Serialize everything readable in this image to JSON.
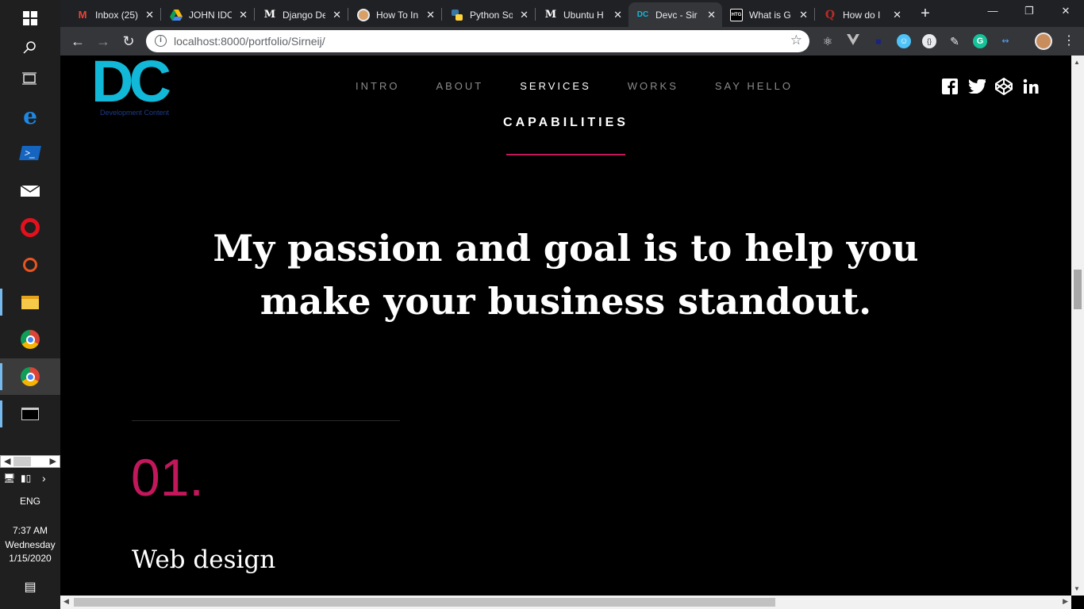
{
  "taskbar": {
    "icons": [
      "windows-start-icon",
      "search-icon",
      "task-view-icon",
      "edge-icon",
      "powershell-icon",
      "mail-icon",
      "opera-icon",
      "ubuntu-icon",
      "file-explorer-icon",
      "chrome-icon",
      "chrome-profile-icon",
      "terminal-icon"
    ],
    "language": "ENG",
    "time": "7:37 AM",
    "day": "Wednesday",
    "date": "1/15/2020"
  },
  "tabs": [
    {
      "title": "Inbox (25)",
      "favicon": "gmail-icon",
      "color": "#ea4335"
    },
    {
      "title": "JOHN IDO",
      "favicon": "drive-icon",
      "color": "#fbbc04"
    },
    {
      "title": "Django De",
      "favicon": "medium-icon",
      "color": "#ffffff"
    },
    {
      "title": "How To In",
      "favicon": "avatar-icon",
      "color": "#d9a066"
    },
    {
      "title": "Python So",
      "favicon": "python-icon",
      "color": "#3776ab"
    },
    {
      "title": "Ubuntu H",
      "favicon": "medium-icon",
      "color": "#ffffff"
    },
    {
      "title": "Devc - Sir",
      "favicon": "devc-icon",
      "color": "#12b8d8",
      "active": true
    },
    {
      "title": "What is G",
      "favicon": "htg-icon",
      "color": "#ffffff"
    },
    {
      "title": "How do I",
      "favicon": "quora-icon",
      "color": "#b92b27"
    }
  ],
  "toolbar": {
    "url": "localhost:8000/portfolio/Sirneij/"
  },
  "site": {
    "logo_text": "DC",
    "logo_tagline": "Development Content",
    "nav": [
      "INTRO",
      "ABOUT",
      "SERVICES",
      "WORKS",
      "SAY HELLO"
    ],
    "nav_active": "SERVICES",
    "social": [
      "facebook-icon",
      "twitter-icon",
      "codepen-icon",
      "linkedin-icon"
    ],
    "section_label": "CAPABILITIES",
    "headline": "My passion and goal is to help you make your business standout.",
    "item_number": "01.",
    "item_title": "Web design"
  },
  "colors": {
    "accent": "#c2185b",
    "logo": "#12b8d8",
    "background": "#000000"
  }
}
